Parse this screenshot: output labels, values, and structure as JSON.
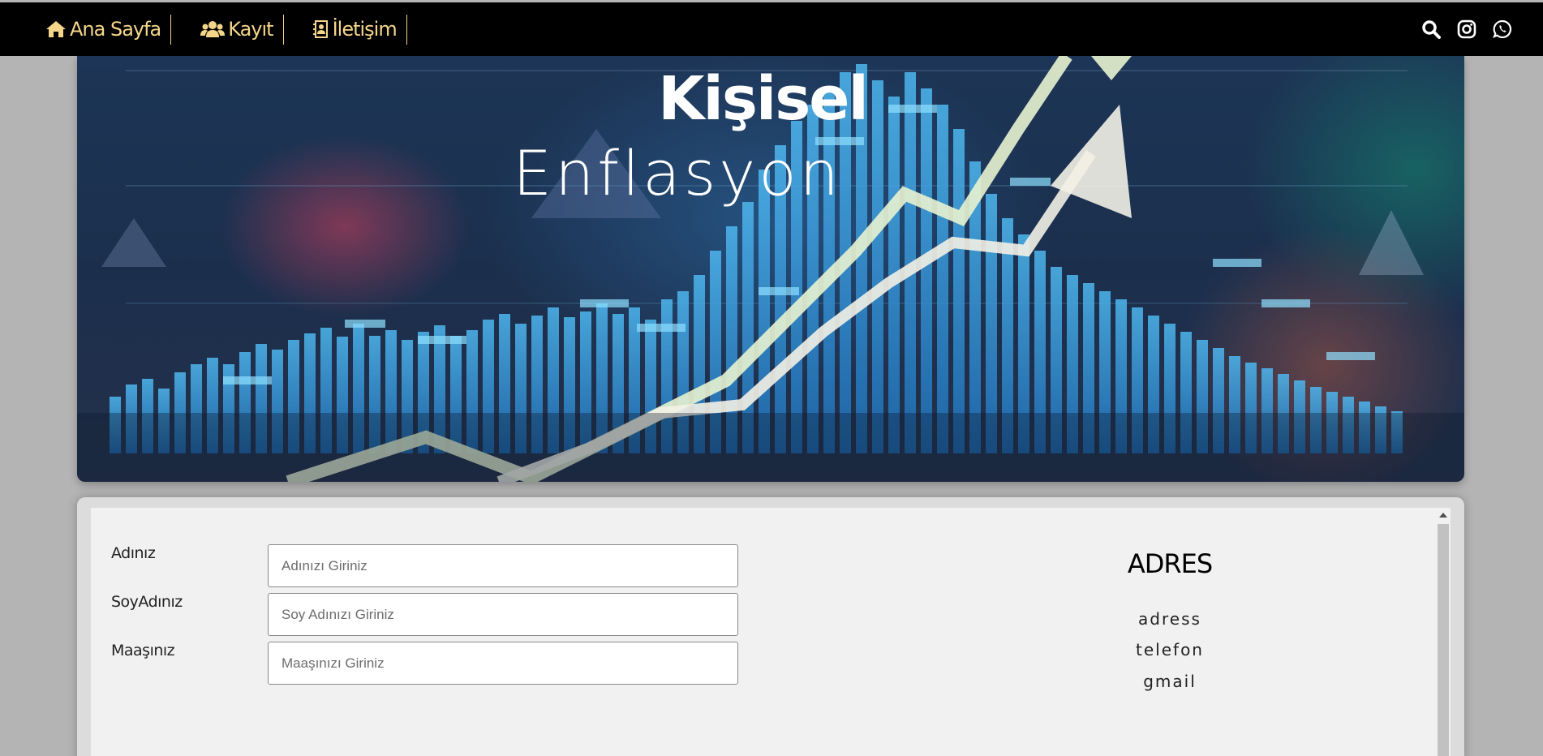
{
  "nav": {
    "items": [
      {
        "label": "Ana Sayfa",
        "icon": "home-icon"
      },
      {
        "label": "Kayıt",
        "icon": "users-icon"
      },
      {
        "label": "İletişim",
        "icon": "contact-book-icon"
      }
    ],
    "right_icons": [
      "search-icon",
      "instagram-icon",
      "whatsapp-icon"
    ],
    "accent_color": "#f5d58a"
  },
  "hero": {
    "title": "Kişisel",
    "subtitle": "Enflasyon"
  },
  "form": {
    "fields": [
      {
        "label": "Adınız",
        "placeholder": "Adınızı Giriniz",
        "value": ""
      },
      {
        "label": "SoyAdınız",
        "placeholder": "Soy Adınızı Giriniz",
        "value": ""
      },
      {
        "label": "Maaşınız",
        "placeholder": "Maaşınızı Giriniz",
        "value": ""
      }
    ]
  },
  "address": {
    "title": "ADRES",
    "lines": [
      "adress",
      "telefon",
      "gmail"
    ]
  }
}
